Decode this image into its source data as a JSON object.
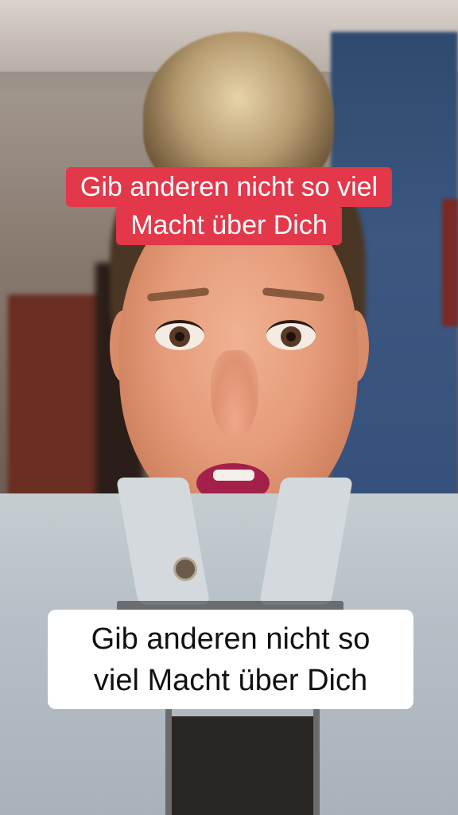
{
  "video": {
    "top_caption": {
      "line1": "Gib anderen nicht so viel",
      "line2": "Macht über Dich",
      "background_color": "#e3374a",
      "text_color": "#ffffff"
    },
    "bottom_caption": {
      "line1": "Gib anderen nicht so",
      "line2": "viel Macht über Dich",
      "background_color": "#ffffff",
      "text_color": "#111111"
    }
  }
}
